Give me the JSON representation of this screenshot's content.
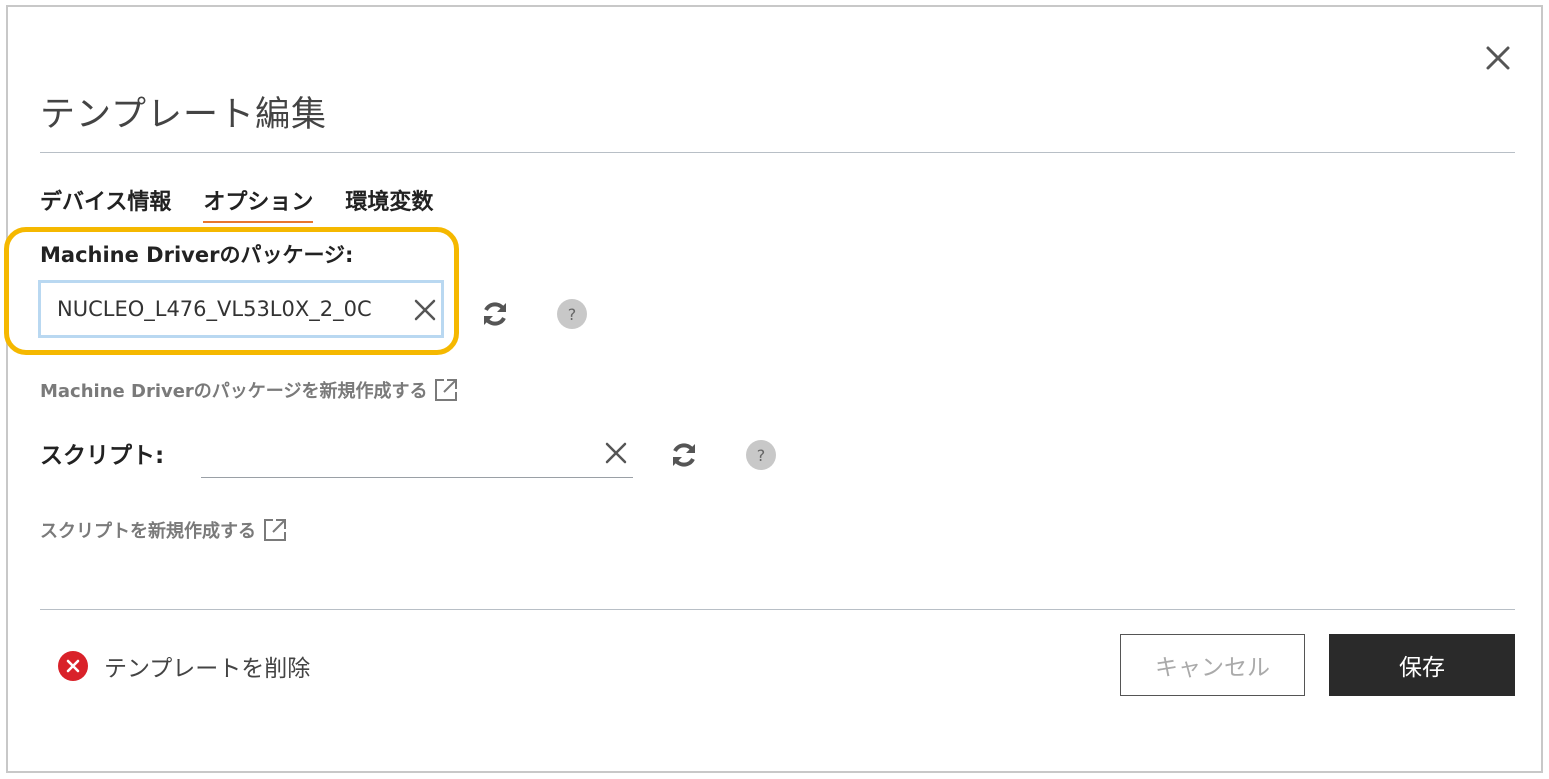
{
  "dialog": {
    "title": "テンプレート編集",
    "close_icon": "close-icon"
  },
  "tabs": [
    {
      "label": "デバイス情報",
      "active": false
    },
    {
      "label": "オプション",
      "active": true
    },
    {
      "label": "環境変数",
      "active": false
    }
  ],
  "package": {
    "label": "Machine Driverのパッケージ:",
    "value": "NUCLEO_L476_VL53L0X_2_0C",
    "create_link": "Machine Driverのパッケージを新規作成する"
  },
  "script": {
    "label": "スクリプト:",
    "value": "",
    "create_link": "スクリプトを新規作成する"
  },
  "help_label": "?",
  "footer": {
    "delete_label": "テンプレートを削除",
    "cancel_label": "キャンセル",
    "save_label": "保存"
  },
  "colors": {
    "highlight": "#f5b800",
    "active_tab_underline": "#e8762c",
    "delete_icon": "#d9222a",
    "save_button": "#2a2a2a"
  }
}
